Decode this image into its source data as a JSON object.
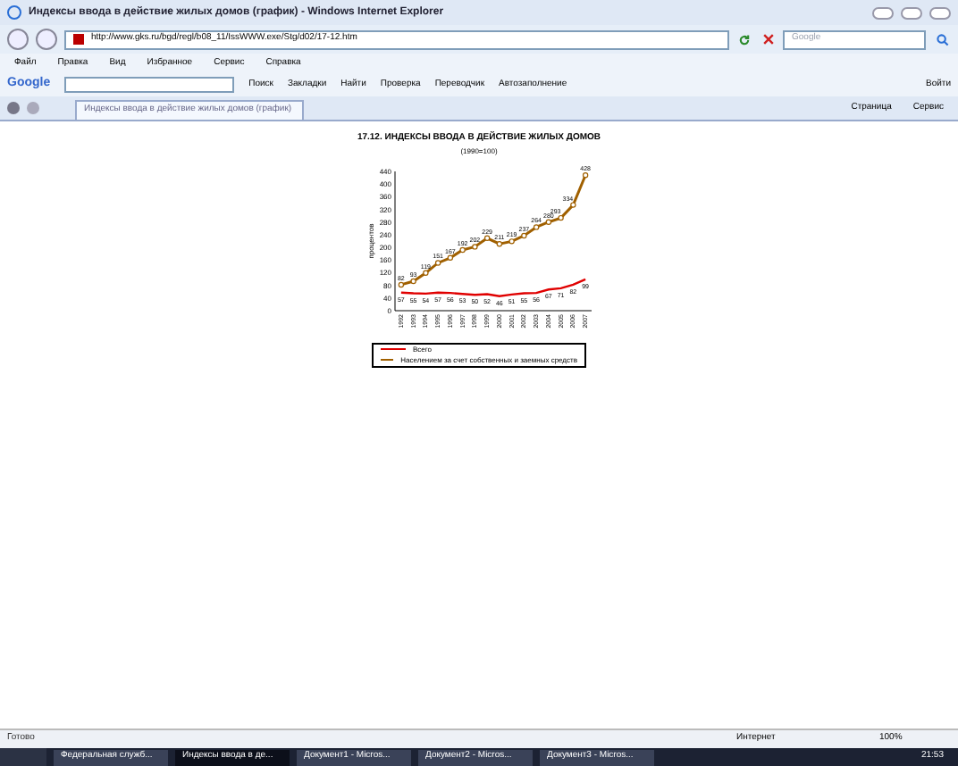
{
  "window": {
    "title": "Индексы ввода в действие жилых домов (график) - Windows Internet Explorer"
  },
  "address_bar": {
    "url": "http://www.gks.ru/bgd/regl/b08_11/IssWWW.exe/Stg/d02/17-12.htm",
    "search_placeholder": "Google"
  },
  "menu": [
    "Файл",
    "Правка",
    "Вид",
    "Избранное",
    "Сервис",
    "Справка"
  ],
  "google_toolbar": {
    "logo": "Google",
    "search_label": "Поиск",
    "items": [
      "Закладки",
      "Найти",
      "Проверка",
      "Переводчик",
      "Автозаполнение"
    ],
    "signin": "Войти"
  },
  "tabs": [
    {
      "label": "Индексы ввода в действие жилых домов (график)",
      "selected": true
    }
  ],
  "command_bar": [
    "Страница",
    "Сервис"
  ],
  "page": {
    "title": "17.12. ИНДЕКСЫ ВВОДА В ДЕЙСТВИЕ ЖИЛЫХ ДОМОВ",
    "subtitle": "(1990=100)",
    "chart_data": {
      "type": "line",
      "ylabel": "процентов",
      "categories": [
        "1992",
        "1993",
        "1994",
        "1995",
        "1996",
        "1997",
        "1998",
        "1999",
        "2000",
        "2001",
        "2002",
        "2003",
        "2004",
        "2005",
        "2006",
        "2007"
      ],
      "ylim": [
        0,
        440
      ],
      "yticks": [
        0,
        40,
        80,
        120,
        160,
        200,
        240,
        280,
        320,
        360,
        400,
        440
      ],
      "data_labels": true,
      "legend": "bottom",
      "series": [
        {
          "name": "Всего",
          "color": "#e00000",
          "values": [
            57,
            55,
            54,
            57,
            56,
            53,
            50,
            52,
            46,
            51,
            55,
            56,
            67,
            71,
            82,
            99
          ]
        },
        {
          "name": "Населением за счет собственных и заемных средств",
          "color": "#a06000",
          "marker": "circle",
          "values": [
            82,
            93,
            119,
            151,
            167,
            192,
            202,
            229,
            211,
            219,
            237,
            264,
            280,
            293,
            334,
            428
          ]
        }
      ]
    }
  },
  "status_bar": {
    "text": "Готово",
    "zone": "Интернет",
    "zoom": "100%"
  },
  "taskbar": {
    "buttons": [
      {
        "label": "Федеральная служб...",
        "selected": false
      },
      {
        "label": "Индексы ввода в де...",
        "selected": true
      },
      {
        "label": "Документ1 - Micros...",
        "selected": false
      },
      {
        "label": "Документ2 - Micros...",
        "selected": false
      },
      {
        "label": "Документ3 - Micros...",
        "selected": false
      }
    ],
    "clock": "21:53"
  }
}
